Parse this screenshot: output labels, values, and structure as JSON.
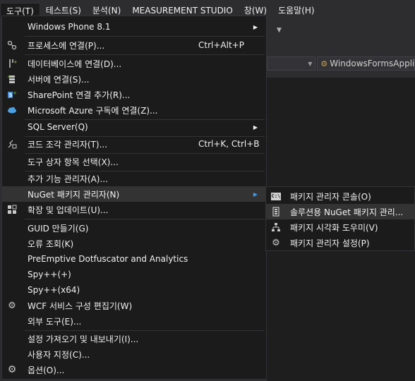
{
  "menubar": {
    "items": [
      {
        "label": "도구(T)",
        "open": true
      },
      {
        "label": "테스트(S)"
      },
      {
        "label": "분석(N)"
      },
      {
        "label": "MEASUREMENT STUDIO"
      },
      {
        "label": "창(W)"
      },
      {
        "label": "도움말(H)"
      }
    ]
  },
  "navbar": {
    "class_combo": "WindowsFormsApplic"
  },
  "tools_menu": {
    "items": [
      {
        "label": "Windows Phone 8.1",
        "submenu": true,
        "icon": ""
      },
      {
        "label": "프로세스에 연결(P)...",
        "shortcut": "Ctrl+Alt+P",
        "icon": "attach-process-icon"
      },
      {
        "label": "데이터베이스에 연결(D)...",
        "icon": "connect-database-icon"
      },
      {
        "label": "서버에 연결(S)...",
        "icon": "connect-server-icon"
      },
      {
        "label": "SharePoint 연결 추가(R)...",
        "icon": "sharepoint-icon"
      },
      {
        "label": "Microsoft Azure 구독에 연결(Z)...",
        "icon": "azure-cloud-icon"
      },
      {
        "label": "SQL Server(Q)",
        "submenu": true
      },
      {
        "label": "코드 조각 관리자(T)...",
        "shortcut": "Ctrl+K, Ctrl+B",
        "icon": "code-snippets-icon"
      },
      {
        "label": "도구 상자 항목 선택(X)..."
      },
      {
        "label": "추가 기능 관리자(A)..."
      },
      {
        "label": "NuGet 패키지 관리자(N)",
        "submenu": true
      },
      {
        "label": "확장 및 업데이트(U)...",
        "icon": "extensions-icon"
      },
      {
        "label": "GUID 만들기(G)"
      },
      {
        "label": "오류 조회(K)"
      },
      {
        "label": "PreEmptive Dotfuscator and Analytics"
      },
      {
        "label": "Spy++(+)"
      },
      {
        "label": "Spy++(x64)"
      },
      {
        "label": "WCF 서비스 구성 편집기(W)",
        "icon": "wcf-gear-icon"
      },
      {
        "label": "외부 도구(E)..."
      },
      {
        "label": "설정 가져오기 및 내보내기(I)..."
      },
      {
        "label": "사용자 지정(C)..."
      },
      {
        "label": "옵션(O)...",
        "icon": "options-gear-icon"
      }
    ]
  },
  "nuget_submenu": {
    "items": [
      {
        "label": "패키지 관리자 콘솔(O)",
        "icon": "console-icon",
        "icon_text": "C:\\"
      },
      {
        "label": "솔루션용 NuGet 패키지 관리...",
        "icon": "nuget-package-icon"
      },
      {
        "label": "패키지 시각화 도우미(V)",
        "icon": "hierarchy-icon"
      },
      {
        "label": "패키지 관리자 설정(P)",
        "icon": "settings-gear-icon"
      }
    ]
  }
}
